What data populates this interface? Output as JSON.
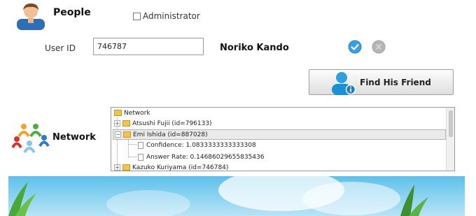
{
  "header": {
    "title": "People",
    "admin_label": "Administrator"
  },
  "user": {
    "id_label": "User ID",
    "id_value": "746787",
    "name": "Noriko Kando"
  },
  "find_button": {
    "label": "Find His Friend"
  },
  "network": {
    "title": "Network",
    "tree": {
      "root": "Network",
      "nodes": [
        {
          "label": "Atsushi Fujii (id=796133)"
        },
        {
          "label": "Emi Ishida (id=887028)",
          "selected": true,
          "children": [
            {
              "label": "Confidence: 1.0833333333333308"
            },
            {
              "label": "Answer Rate: 0.14686029655835436"
            }
          ]
        },
        {
          "label": "Kazuko Kuriyama (id=746784)"
        }
      ]
    }
  },
  "colors": {
    "confirm": "#3a9ee0",
    "cancel": "#b5b5b5",
    "folder": "#f0c450",
    "banner_sky": "#6ec6ee"
  },
  "icons": {
    "people": "user-avatar-icon",
    "confirm": "check-circle-icon",
    "cancel": "close-circle-icon",
    "find": "user-info-icon",
    "network": "people-network-icon"
  }
}
